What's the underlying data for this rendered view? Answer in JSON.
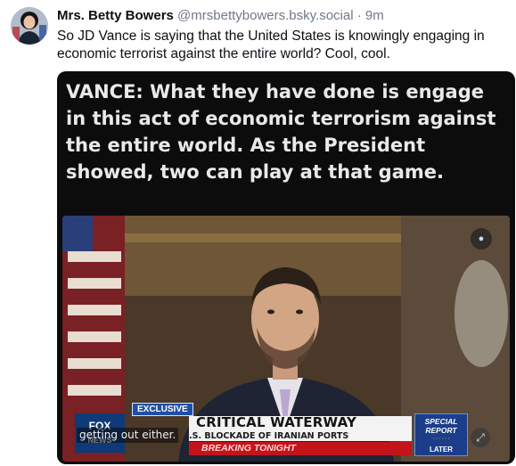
{
  "post": {
    "author_name": "Mrs. Betty Bowers",
    "author_handle": "@mrsbettybowers.bsky.social",
    "separator": "·",
    "timestamp": "9m",
    "text": "So JD Vance is saying that the United States is knowingly engaging in economic terrorist against the entire world? Cool, cool."
  },
  "image": {
    "caption": "VANCE: What they have done is engage in this act of economic terrorism against the entire world. As the President showed, two can play at that game.",
    "video": {
      "badge": "EXCLUSIVE",
      "headline": "CRITICAL WATERWAY",
      "subheadline": ".S. BLOCKADE OF IRANIAN PORTS",
      "breaking": "BREAKING TONIGHT",
      "closed_caption": "getting out either.",
      "special_report_title": "SPECIAL REPORT",
      "special_report_later": "LATER",
      "network_logo": "fox-news-logo",
      "control_icon": "captions-icon",
      "expand_icon": "expand-icon"
    }
  },
  "colors": {
    "name": "#0b0f14",
    "muted": "#6f7a86",
    "chyron_red": "#c4141b",
    "fox_blue": "#1f4fa8"
  }
}
